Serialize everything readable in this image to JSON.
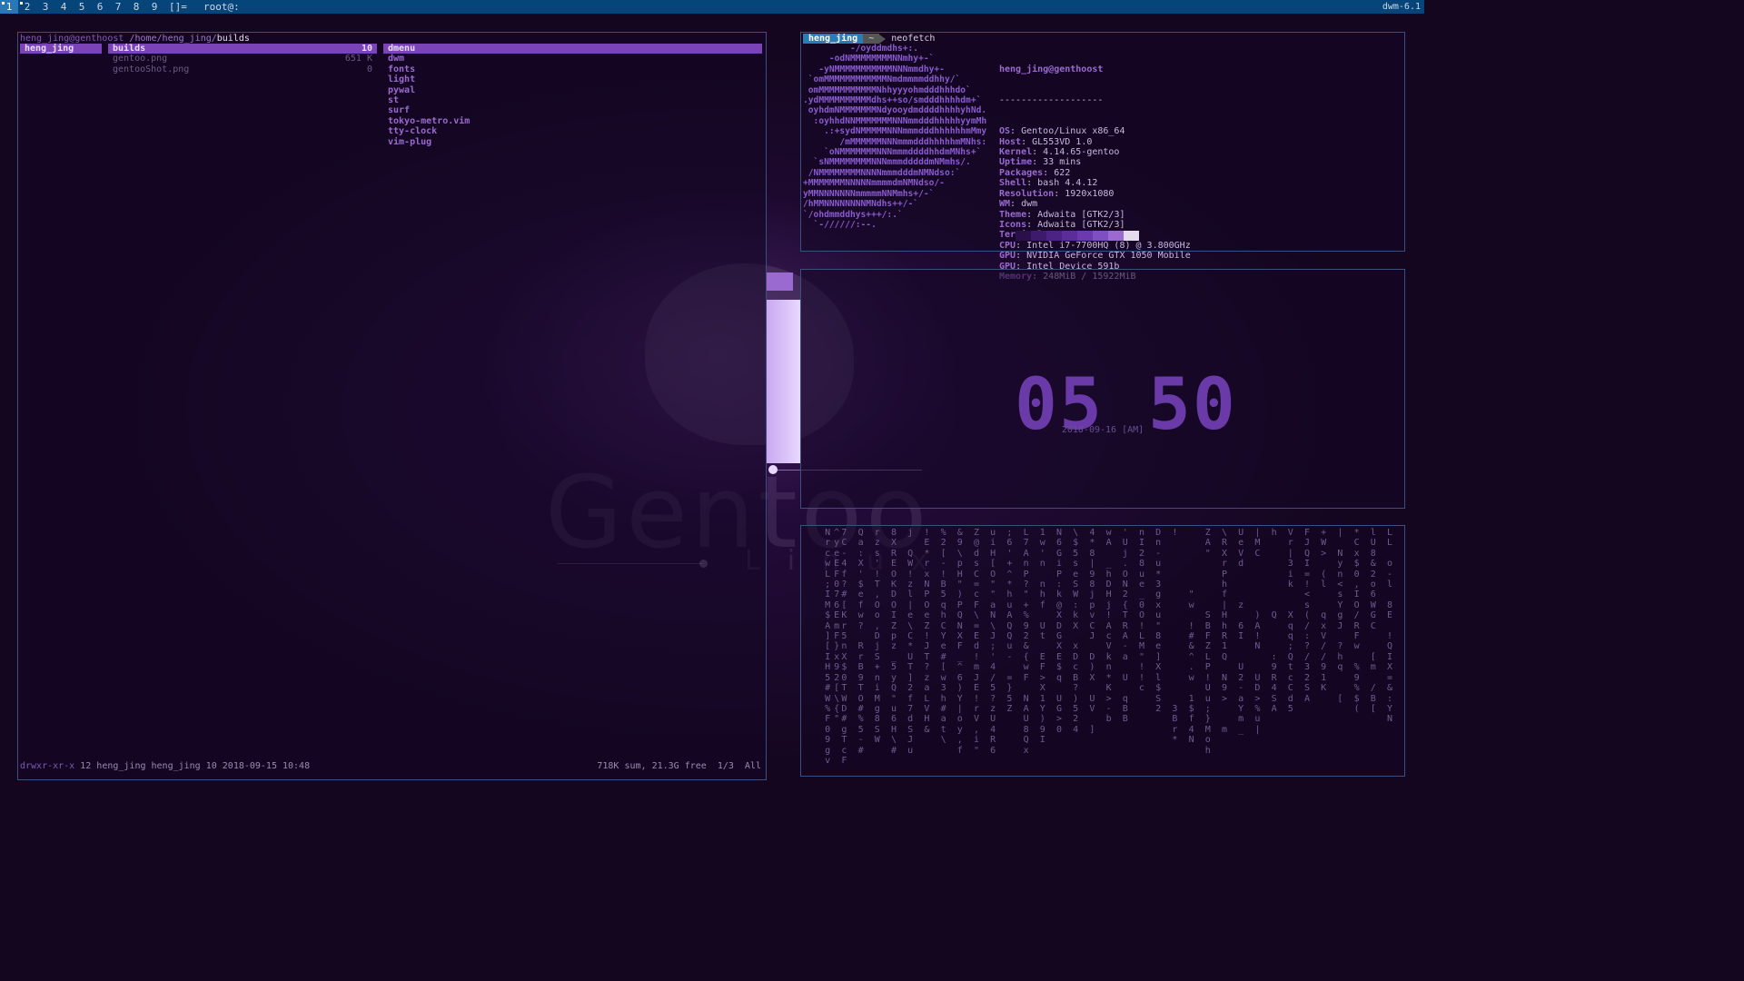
{
  "bar": {
    "tags": [
      "1",
      "2",
      "3",
      "4",
      "5",
      "6",
      "7",
      "8",
      "9"
    ],
    "selected_tag": "1",
    "layout": "[]=",
    "window_title": "root@:",
    "status": "dwm-6.1"
  },
  "ranger": {
    "user_host": "heng_jing@genthoost",
    "path": "/home/heng_jing/",
    "current": "builds",
    "parent": [
      "heng_jing"
    ],
    "files": [
      {
        "name": "builds",
        "size": "10",
        "selected": true
      },
      {
        "name": "gentoo.png",
        "size": "651 K",
        "selected": false
      },
      {
        "name": "gentooShot.png",
        "size": "0",
        "selected": false
      }
    ],
    "preview": [
      "dmenu",
      "dwm",
      "fonts",
      "light",
      "pywal",
      "st",
      "surf",
      "tokyo-metro.vim",
      "tty-clock",
      "vim-plug"
    ],
    "footer_left": "drwxr-xr-x 12 heng_jing heng_jing 10 2018-09-15 10:48",
    "footer_perm": "drwxr-xr-x",
    "footer_rest": " 12 heng_jing heng_jing 10 2018-09-15 10:48",
    "footer_right": "718K sum, 21.3G free  1/3  All"
  },
  "neofetch": {
    "prompt_user": "heng_jing",
    "prompt_dir": "~",
    "command": "neofetch",
    "ascii": "         -/oyddmdhs+:.\n     -odNMMMMMMMMNNmhy+-`\n   -yNMMMMMMMMMMMNNNmmdhy+-\n `omMMMMMMMMMMMMNmdmmmmddhhy/`\n omMMMMMMMMMMMNhhyyyohmdddhhhdo`\n.ydMMMMMMMMMMdhs++so/smdddhhhhdm+`\n oyhdmNMMMMMMMNdyooydmddddhhhhyhNd.\n  :oyhhdNNMMMMMMMNNNmmdddhhhhhyymMh\n    .:+sydNMMMMMNNNmmmdddhhhhhhmMmy\n       /mMMMMMMNNNmmmdddhhhhhmMNhs:\n    `oNMMMMMMMNNNmmmddddhhdmMNhs+`\n  `sNMMMMMMMMNNNmmmdddddmNMmhs/.\n /NMMMMMMMMNNNNmmmdddmNMNdso:`\n+MMMMMMMNNNNNmmmmdmNMNdso/-\nyMMNNNNNNNmmmmmNNMmhs+/-`\n/hMMNNNNNNNNMNdhs++/-`\n`/ohdmmddhys+++/:.`\n  `-//////:--.",
    "user_host": "heng_jing@genthoost",
    "separator": "-------------------",
    "info": [
      {
        "key": "OS",
        "value": "Gentoo/Linux x86_64"
      },
      {
        "key": "Host",
        "value": "GL553VD 1.0"
      },
      {
        "key": "Kernel",
        "value": "4.14.65-gentoo"
      },
      {
        "key": "Uptime",
        "value": "33 mins"
      },
      {
        "key": "Packages",
        "value": "622"
      },
      {
        "key": "Shell",
        "value": "bash 4.4.12"
      },
      {
        "key": "Resolution",
        "value": "1920x1080"
      },
      {
        "key": "WM",
        "value": "dwm"
      },
      {
        "key": "Theme",
        "value": "Adwaita [GTK2/3]"
      },
      {
        "key": "Icons",
        "value": "Adwaita [GTK2/3]"
      },
      {
        "key": "Terminal",
        "value": "st"
      },
      {
        "key": "CPU",
        "value": "Intel i7-7700HQ (8) @ 3.800GHz"
      },
      {
        "key": "GPU",
        "value": "NVIDIA GeForce GTX 1050 Mobile"
      },
      {
        "key": "GPU",
        "value": "Intel Device 591b"
      },
      {
        "key": "Memory",
        "value": "248MiB / 15922MiB"
      }
    ],
    "swatch_colors": [
      "#2a0f4a",
      "#3d1a6b",
      "#4c2384",
      "#5a2d99",
      "#6b3bad",
      "#7e4fc0",
      "#9a6ad0",
      "#e4dcee"
    ]
  },
  "clock": {
    "time": "05 50",
    "date": "2018-09-16 [AM]"
  },
  "matrix": {
    "columns": [
      "     ^\n     y\n     e\n     E\n     F\n     0\n     7\n     6\n     E\n     m\n     F\n     }\n     x\n     9\n     2\n     [\n     \\\n     {\n     \"",
      "N\nr\nc\nw\nL\n;\nI\nM\n$\nA\n]\n[\nI\nH\n5\n#\nW\n%\nF\n0\n9\ng\nv",
      "7\nC\n-\n4\nf\n?\n#\n[\nK\nr\n5\nn\nX\n$\n0\nT\nW\nD\n#\ng\nT\nc\nF",
      "Q\na\n:\nX\n'\n$\ne\nf\nw\n?\n\nR\nr\nB\n9\nT\nO\n#\n%\n5\n-\n#",
      "r\nz\ns\n'\n!\nT\n,\nO\no\n,\nD\nj\nS\n+\nn\ni\nM\ng\n8\nS\nW",
      "8\nX\nR\nE\nO\nK\nD\nO\nI\nZ\np\nz\n_\n5\ny\nQ\n\"\nu\n6\nH\n\\\n#",
      "j\n\nQ\nW\n!\nz\nl\n|\ne\n\\\nC\n*\nU\nT\n]\n2\nf\n7\nd\nS\nJ\nu",
      "!\nE\n*\nr\nx\nN\nP\nO\ne\nZ\n!\nJ\nT\n?\nz\na\nL\nV\nH\n&\n",
      "%\n2\n[\n-\n!\nB\n5\nq\nh\nC\nY\ne\n#\n[\nw\n3\nh\n#\na\nt\n\\",
      "&\n9\n\\\np\nH\n\"\n)\nP\nQ\nN\nX\nF\n_\n^\n6\n)\nY\n|\no\ny\n,\nf",
      "Z\n@\nd\ns\nC\n=\nc\nF\n\\\n=\nE\nd\n!\nm\nJ\nE\n!\nr\nV\n,\ni\n\"",
      "u\ni\nH\n[\nO\n\"\n\"\na\nN\n\\\nJ\n;\n'\n4\n/\n5\n?\nz\nU\n4\nR\n6",
      ";\n6\n'\n+\n^\n*\nh\nu\nA\nQ\nQ\nu\n-\n\n=\n}\n5\nZ\n\n\n\n",
      "L\n7\nA\nn\nP\n?\n\"\n+\n%\n9\n2\n&\n{\nw\nF\n\nN\nA\nU\n8\nQ\nx",
      "1\nw\n'\nn\n \nn\nh\nf\n \nU\nt\n \nE\nF\n>\nX\n1\nY\n)\n9\nI",
      "N\n6\nG\ni\nP\n:\nk\n@\nX\nD\nG\nX\nE\n$\nq\n \nU\nG\n>\n0",
      "\\\n$\n5\ns\ne\nS\nW\n:\nk\nX\n \nx\nD\nc\nB\n?\n)\n5\n2\n4",
      "4\n*\n8\n|\n9\n8\nj\np\nv\nC\nJ\n \nD\n)\nX\n \nU\nV\n \n]",
      "w\nA\n\n_\nh\nD\nH\nj\n!\nA\nc\nV\nk\nn\n*\nK\n>\n-\nb",
      "'\nU\nj\n.\nO\nN\n2\n{\nT\nR\nA\n-\na\n \nU\n \nq\nB\nB",
      "n\nI\n2\n8\nu\ne\n_\n0\nO\n!\nL\nM\n\"\n!\n!\nc",
      "D\nn\n-\nu\n*\n3\ng\nx\nu\n\"\n8\ne\n]\nX\nl\n$\nS\n2",
      "!\n \n \n \n \n \n \n \n \n \n \n \n \n \n \n \n \n3\nB\nr\n*",
      "\n\n\n\n\n\n\"\nw\n\n!\n#\n&\n^\n.\nw\n \n1\n$\nf\n4\nN",
      "Z\nA\n\"\n \n \n \n \n \nS\nB\nF\nZ\nL\nP\n!\nU\nu\n;\n}\nM\no\nh",
      "\\\nR\nX\nr\nP\nh\nf\n|\nH\nh\nR\n1\nQ\n \nN\n9\n>\n \n \nm",
      "U\ne\nV\nd\n \n \n \nz\n \n6\nI\n \n \nU\n2\n-\na\nY\nm\n_",
      "|\nM\nC\n \n \n \n \n \n)\nA\n!\nN\n \n \nU\nD\n>\n%\nu\n|",
      "h\n \n \n \n \n \n \n \nQ\n \n \n \n:\n9\nR\n4\nS\nA",
      "V\nr\n|\n3\ni\nk\n \n \nX\nq\nq\n;\nQ\nt\nc\nC\nd\n5",
      "F\nJ\nQ\nI\n=\n!\n<\ns\n(\n/\n:\n?\n/\n3\n2\nS\nA",
      "+\nW\n>\n \n(\nl\n \n \nq\nx\nV\n/\n/\n9\n1\nK",
      "|\n \nN\ny\nn\n<\ns\nY\ng\nJ\n \n?\nh\nq\n \n \n[",
      "*\nC\nx\n$\n0\n,\nI\nO\n/\nR\nF\nw\n \n%\n9\n%\n$\n(",
      "l\nU\n8\n&\n2\no\n6\nW\nG\nC\n \n \n[\nm\n \n/\nB\n[",
      "L\nL\n \no\n-\nl\n \n8\nE\n \n!\nQ\nI\nX\n=\n&\n:\nY\nN"
    ]
  }
}
